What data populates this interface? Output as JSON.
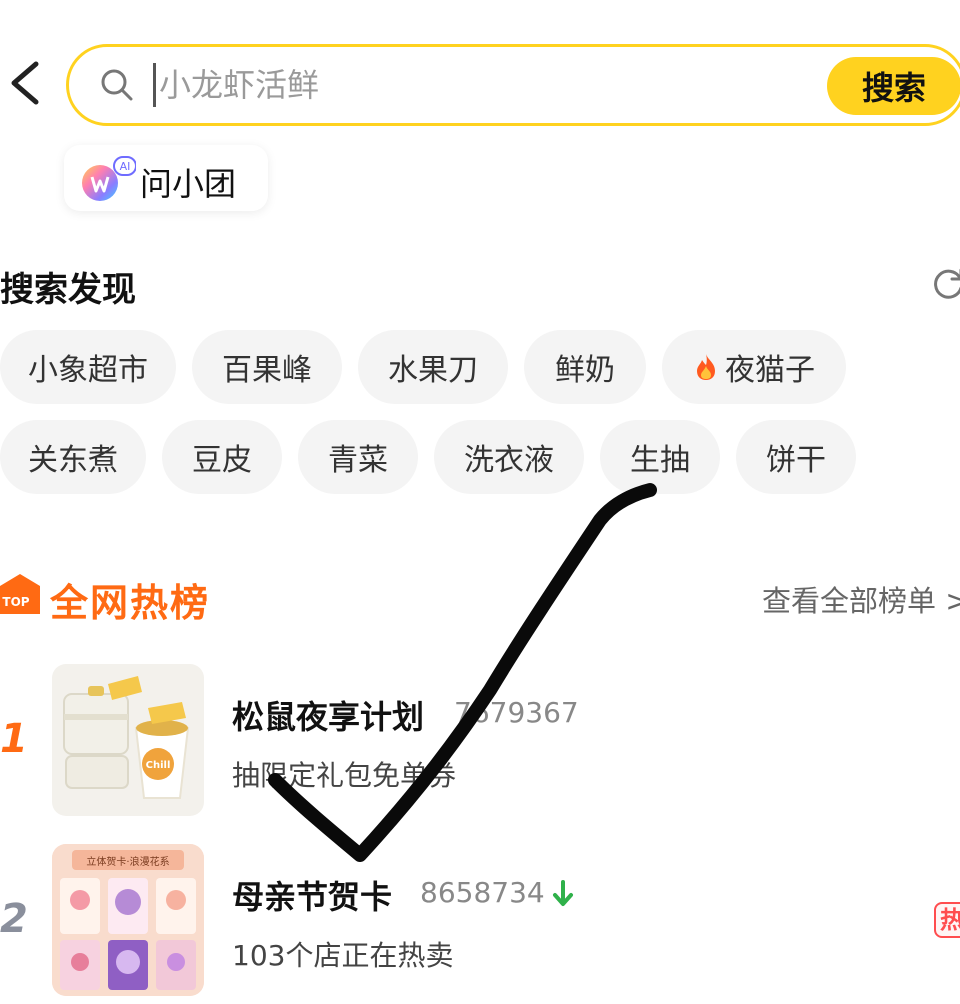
{
  "search": {
    "placeholder": "小龙虾活鲜",
    "button_label": "搜索"
  },
  "ai_assistant": {
    "badge": "AI",
    "label": "问小团"
  },
  "discover": {
    "title": "搜索发现",
    "row1": [
      "小象超市",
      "百果峰",
      "水果刀",
      "鲜奶",
      "夜猫子"
    ],
    "row2": [
      "关东煮",
      "豆皮",
      "青菜",
      "洗衣液",
      "生抽",
      "饼干"
    ]
  },
  "hot_list": {
    "badge": "TOP",
    "title": "全网热榜",
    "view_all": "查看全部榜单 >",
    "items": [
      {
        "rank": "1",
        "title": "松鼠夜享计划",
        "count": "7679367",
        "subtitle": "抽限定礼包免单券",
        "thumb_text": "Chill"
      },
      {
        "rank": "2",
        "title": "母亲节贺卡",
        "count": "8658734",
        "subtitle": "103个店正在热卖",
        "thumb_text": "立体贺卡·浪漫花系",
        "trend": "down",
        "tag": "热"
      }
    ]
  },
  "colors": {
    "accent_yellow": "#ffd21f",
    "hot_orange": "#ff6a13",
    "trend_down_green": "#2fb14a",
    "hot_tag_red": "#ff4d4f"
  },
  "icons": {
    "back": "chevron-left-icon",
    "search": "search-icon",
    "refresh": "refresh-icon",
    "fire": "fire-icon",
    "down": "arrow-down-icon"
  }
}
